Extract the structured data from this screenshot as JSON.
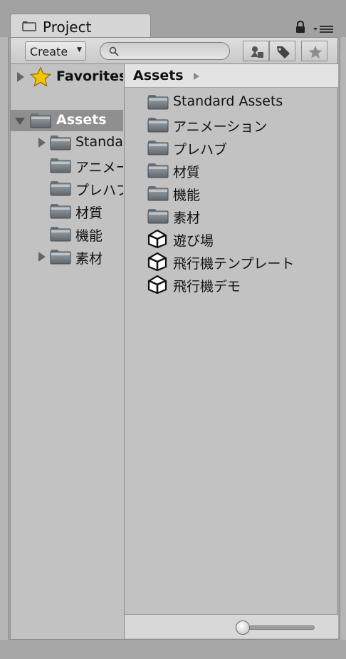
{
  "tab": {
    "title": "Project",
    "icon": "folder-icon"
  },
  "header_icons": {
    "lock": "lock-icon",
    "menu": "panel-menu-icon"
  },
  "toolbar": {
    "create_label": "Create",
    "create_arrow": "▼",
    "search_value": "",
    "search_icon": "magnifier-icon",
    "filter_buttons": [
      "filter-by-type-icon",
      "filter-by-label-icon",
      "favorites-star-icon"
    ]
  },
  "tree": {
    "favorites_label": "Favorites",
    "assets_label": "Assets",
    "children": [
      "Standard Assets",
      "アニメーション",
      "プレハブ",
      "材質",
      "機能",
      "素材"
    ]
  },
  "content": {
    "breadcrumb": "Assets",
    "items": [
      {
        "name": "Standard Assets",
        "icon": "folder-icon"
      },
      {
        "name": "アニメーション",
        "icon": "folder-icon"
      },
      {
        "name": "プレハブ",
        "icon": "folder-icon"
      },
      {
        "name": "材質",
        "icon": "folder-icon"
      },
      {
        "name": "機能",
        "icon": "folder-icon"
      },
      {
        "name": "素材",
        "icon": "folder-icon"
      },
      {
        "name": "遊び場",
        "icon": "unity-scene-icon"
      },
      {
        "name": "飛行機テンプレート",
        "icon": "unity-scene-icon"
      },
      {
        "name": "飛行機デモ",
        "icon": "unity-scene-icon"
      }
    ],
    "icon_size_level": 0
  },
  "colors": {
    "panel_bg": "#c2c2c2",
    "selection": "#8f8f8f",
    "star": "#f5c400"
  }
}
